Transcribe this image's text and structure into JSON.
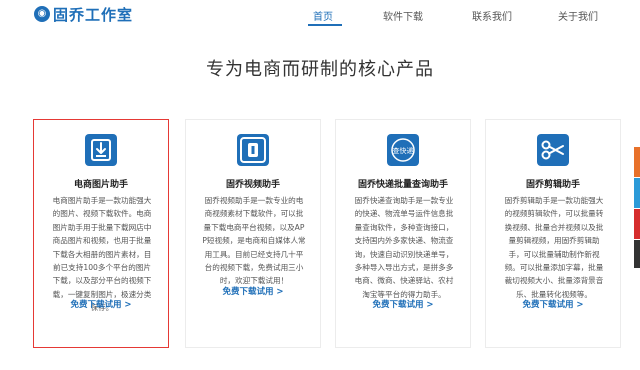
{
  "header": {
    "logo_text": "固乔工作室",
    "logo_mark": "◉",
    "nav": [
      "首页",
      "软件下载",
      "联系我们",
      "关于我们"
    ]
  },
  "headline": "专为电商而研制的核心产品",
  "cards": [
    {
      "icon": "download-icon",
      "title": "电商图片助手",
      "desc": "电商图片助手是一款功能强大的图片、视频下载软件。电商图片助手用于批量下载网店中商品图片和视频，也用于批量下载各大相册的图片素材，目前已支持100多个平台的图片下载，以及部分平台的视频下载，一键复制图片，极速分类保存。",
      "link": "免费下载试用 >"
    },
    {
      "icon": "video-icon",
      "title": "固乔视频助手",
      "desc": "固乔视频助手是一款专业的电商视频素材下载软件，可以批量下载电商平台视频，以及APP短视频，是电商和自媒体人常用工具。目前已经支持几十平台的视频下载，免费试用三小时，欢迎下载试用！",
      "link": "免费下载试用 >"
    },
    {
      "icon": "express-icon",
      "icon_text": "查快递",
      "title": "固乔快递批量查询助手",
      "desc": "固乔快递查询助手是一款专业的快递、物流单号运件信息批量查询软件，多种查询接口，支持国内外多家快递、物流查询，快速自动识别快递单号，多种导入导出方式，是拼多多电商、微商、快递驿站、农村淘宝等平台的得力助手。",
      "link": "免费下载试用 >"
    },
    {
      "icon": "scissors-icon",
      "title": "固乔剪辑助手",
      "desc": "固乔剪辑助手是一款功能强大的视频剪辑软件，可以批量转换视频、批量合并视频以及批量剪辑视频，用固乔剪辑助手，可以批量辅助制作新视频。可以批量添加字幕，批量裁切视频大小、批量添背景音乐、批量转化视频等。",
      "link": "免费下载试用 >"
    }
  ],
  "colors": {
    "brand_blue": "#1f6fb8",
    "selected_border": "#e53935",
    "side_tabs": [
      "#e8712a",
      "#2b9ad8",
      "#d62d2d",
      "#333333"
    ]
  }
}
